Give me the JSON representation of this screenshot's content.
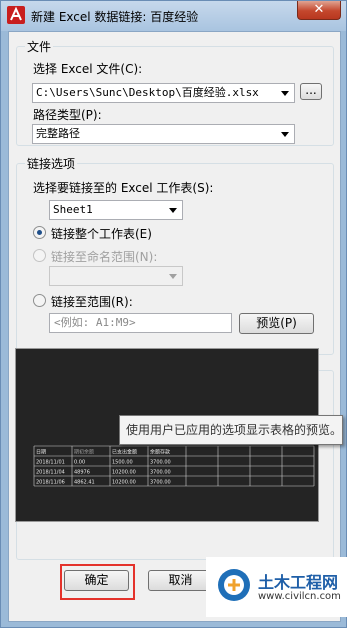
{
  "window": {
    "title": "新建 Excel 数据链接: 百度经验",
    "close_symbol": "✕"
  },
  "file_group": {
    "title": "文件",
    "select_label": "选择 Excel 文件(C):",
    "file_path": "C:\\Users\\Sunc\\Desktop\\百度经验.xlsx",
    "browse_label": "...",
    "path_type_label": "路径类型(P):",
    "path_type_value": "完整路径"
  },
  "link_group": {
    "title": "链接选项",
    "sheet_label": "选择要链接至的 Excel 工作表(S):",
    "sheet_value": "Sheet1",
    "radio_entire": "链接整个工作表(E)",
    "radio_named": "链接至命名范围(N):",
    "radio_range": "链接至范围(R):",
    "range_placeholder": "<例如: A1:M9>",
    "preview_button": "预览(P)"
  },
  "preview": {
    "checkbox_label": "预览",
    "checked": true,
    "tooltip": "使用用户已应用的选项显示表格的预览。",
    "table_headers": [
      "日期",
      "期初余额",
      "已支出金额",
      "余额存款",
      "",
      "",
      "",
      ""
    ],
    "table_rows": [
      [
        "2018/11/01",
        "0.00",
        "1500.00",
        "3700.00",
        "",
        "",
        "",
        ""
      ],
      [
        "2018/11/04",
        "48976",
        "10200.00",
        "3700.00",
        "",
        "",
        "",
        ""
      ],
      [
        "2018/11/06",
        "4862.41",
        "10200.00",
        "3700.00",
        "",
        "",
        "",
        ""
      ]
    ]
  },
  "buttons": {
    "ok": "确定",
    "cancel": "取消"
  },
  "watermark": {
    "brand": "土木工程网",
    "url": "www.civilcn.com"
  },
  "colors": {
    "highlight_box": "#e4322b",
    "preview_bg": "#242424"
  }
}
